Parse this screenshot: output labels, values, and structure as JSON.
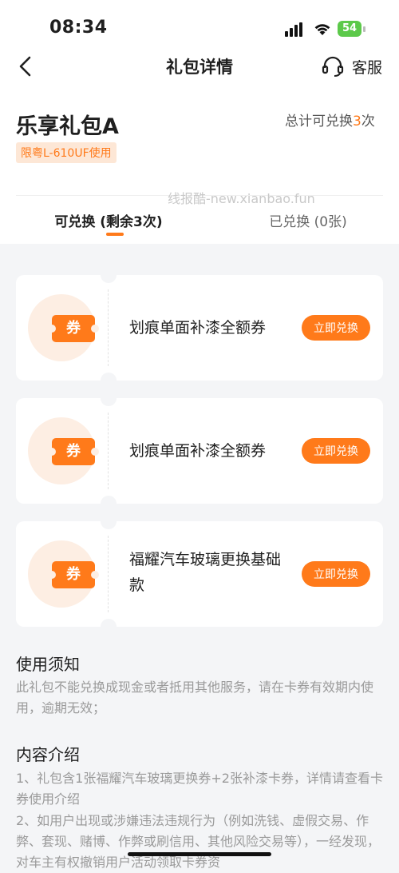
{
  "status": {
    "time": "08:34",
    "battery": "54"
  },
  "header": {
    "title": "礼包详情",
    "customer_service": "客服"
  },
  "package": {
    "name": "乐享礼包A",
    "total_prefix": "总计可兑换",
    "total_count": "3",
    "total_suffix": "次",
    "limit": "限粤L-610UF使用"
  },
  "watermark": "线报酷-new.xianbao.fun",
  "tabs": [
    {
      "label": "可兑换 (剩余3次)"
    },
    {
      "label": "已兑换 (0张)"
    }
  ],
  "coupons": [
    {
      "icon_text": "券",
      "title": "划痕单面补漆全额券",
      "button": "立即兑换"
    },
    {
      "icon_text": "券",
      "title": "划痕单面补漆全额券",
      "button": "立即兑换"
    },
    {
      "icon_text": "券",
      "title": "福耀汽车玻璃更换基础款",
      "button": "立即兑换"
    }
  ],
  "notice": {
    "title": "使用须知",
    "text": "此礼包不能兑换成现金或者抵用其他服务，请在卡券有效期内使用，逾期无效；"
  },
  "intro": {
    "title": "内容介绍",
    "line1": "1、礼包含1张福耀汽车玻璃更换券+2张补漆卡券，详情请查看卡券使用介绍",
    "line2": "2、如用户出现或涉嫌违法违规行为（例如洗钱、虚假交易、作弊、套现、赌博、作弊或刷信用、其他风险交易等），一经发现，对车主有权撤销用户活动领取卡券资"
  },
  "colors": {
    "accent": "#ff7a1a",
    "badge_bg": "#fde7d6",
    "page_bg": "#f4f5f7"
  }
}
